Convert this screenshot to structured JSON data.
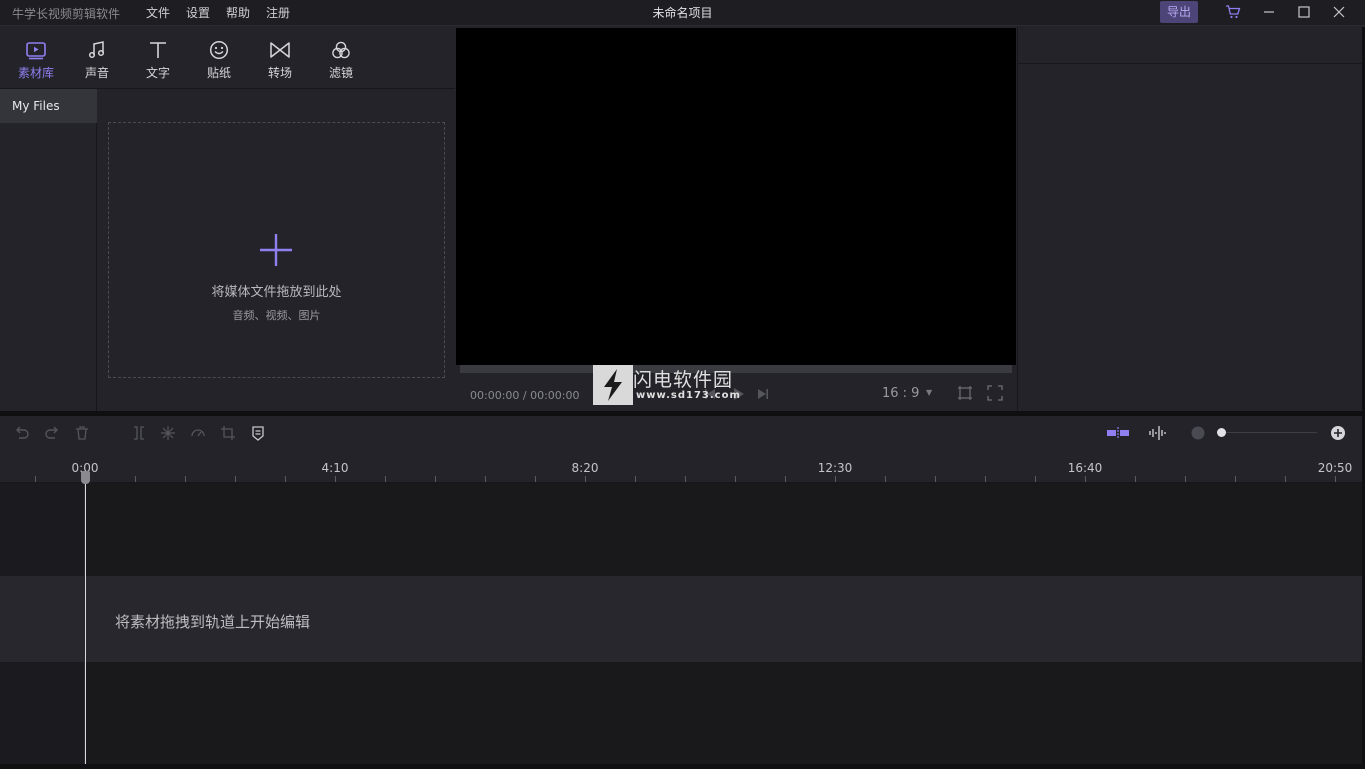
{
  "app": {
    "name": "牛学长视频剪辑软件",
    "menus": [
      "文件",
      "设置",
      "帮助",
      "注册"
    ],
    "project_title": "未命名项目",
    "export_label": "导出"
  },
  "media_tabs": [
    {
      "label": "素材库",
      "icon": "media-library-icon",
      "active": true
    },
    {
      "label": "声音",
      "icon": "music-note-icon",
      "active": false
    },
    {
      "label": "文字",
      "icon": "text-icon",
      "active": false
    },
    {
      "label": "贴纸",
      "icon": "sticker-icon",
      "active": false
    },
    {
      "label": "转场",
      "icon": "transition-icon",
      "active": false
    },
    {
      "label": "滤镜",
      "icon": "filter-icon",
      "active": false
    }
  ],
  "files": {
    "folder_label": "My Files",
    "drop_main": "将媒体文件拖放到此处",
    "drop_sub": "音频、视频、图片"
  },
  "player": {
    "timecode": "00:00:00 / 00:00:00",
    "aspect_ratio": "16 : 9",
    "progress": 0
  },
  "watermark": {
    "title": "闪电软件园",
    "url": "www.sd173.com"
  },
  "timeline": {
    "ruler_labels": [
      "0:00",
      "4:10",
      "8:20",
      "12:30",
      "16:40",
      "20:50"
    ],
    "track_hint": "将素材拖拽到轨道上开始编辑",
    "zoom_level": 0
  },
  "colors": {
    "accent": "#8f7ff0",
    "export_bg": "#4d4478",
    "background": "#232329"
  }
}
